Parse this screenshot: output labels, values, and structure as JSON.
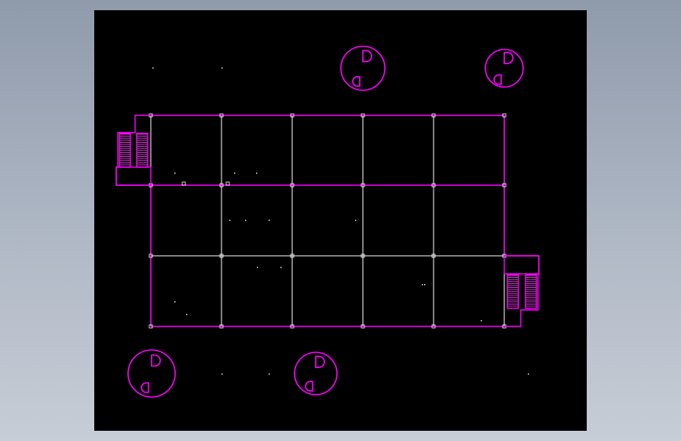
{
  "drawing": {
    "background": "#000000",
    "canvas_background": "#a4aebb",
    "colors": {
      "outline": "#ff00ff",
      "grid": "#ffffff",
      "column_marker": "#ffffff",
      "stair": "#ff44ff"
    },
    "grid": {
      "columns": 6,
      "rows": 4
    },
    "stairs": [
      {
        "name": "left-stair",
        "flights": 2
      },
      {
        "name": "right-stair",
        "flights": 2
      }
    ],
    "round_elements": [
      {
        "name": "round-plan-top-center"
      },
      {
        "name": "round-plan-top-right"
      },
      {
        "name": "round-plan-bottom-left"
      },
      {
        "name": "round-plan-bottom-center"
      }
    ]
  }
}
